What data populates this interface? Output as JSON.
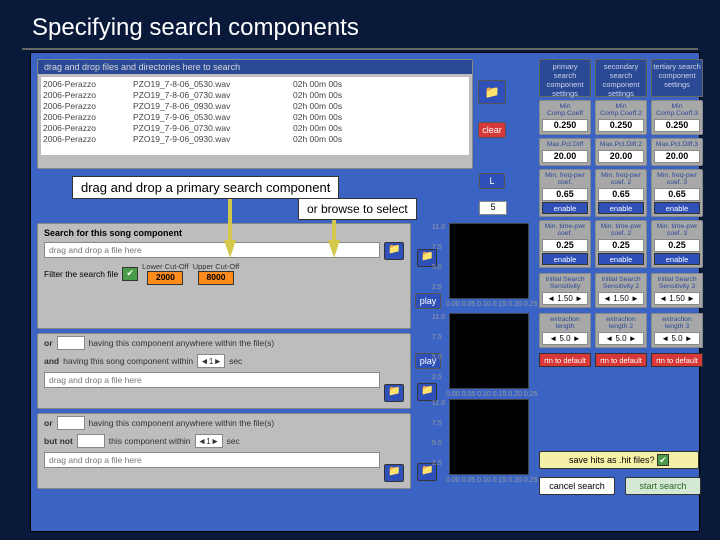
{
  "slide": {
    "title": "Specifying search components"
  },
  "callouts": {
    "main": "drag and drop a primary search component",
    "sub": "or browse to select"
  },
  "fileDrop": {
    "header": "drag and drop files and directories here to search",
    "rows": [
      {
        "a": "2006-Perazzo",
        "b": "PZO19_7-8-06_0530.wav",
        "c": "02h 00m 00s"
      },
      {
        "a": "2006-Perazzo",
        "b": "PZO19_7-8-06_0730.wav",
        "c": "02h 00m 00s"
      },
      {
        "a": "2006-Perazzo",
        "b": "PZO19_7-8-06_0930.wav",
        "c": "02h 00m 00s"
      },
      {
        "a": "2006-Perazzo",
        "b": "PZO19_7-9-06_0530.wav",
        "c": "02h 00m 00s"
      },
      {
        "a": "2006-Perazzo",
        "b": "PZO19_7-9-06_0730.wav",
        "c": "02h 00m 00s"
      },
      {
        "a": "2006-Perazzo",
        "b": "PZO19_7-9-06_0930.wav",
        "c": "02h 00m 00s"
      }
    ]
  },
  "buttons": {
    "clear": "clear",
    "play": "play",
    "L": "L",
    "enable": "enable",
    "rtn": "rtn to default",
    "save": "save hits as .hit files?",
    "cancel": "cancel search",
    "start": "start search"
  },
  "search1": {
    "label": "Search for this song component",
    "drop": "drag and drop a file here",
    "filter": "Filter the search file",
    "lowLbl": "Lower Cut-Off",
    "low": "2000",
    "upLbl": "Upper Cut-Off",
    "up": "8000"
  },
  "search2": {
    "or": "or",
    "orTxt": "having this component anywhere within the file(s)",
    "and": "and",
    "andTxt": "having this song component within",
    "spin": "1",
    "sec": "sec",
    "drop": "drag and drop a file here"
  },
  "search3": {
    "or": "or",
    "orTxt": "having this component anywhere within the file(s)",
    "butnot": "but not",
    "bnTxt": "this component within",
    "spin": "1",
    "sec": "sec",
    "drop": "drag and drop a file here"
  },
  "five": "5",
  "settings": {
    "headers": [
      "primary search component settings",
      "secondary search component settings",
      "tertiary search component settings"
    ],
    "rows": [
      {
        "lbl": [
          "Min Comp.Coeff",
          "Min Comp.Coeff.2",
          "Min Comp.Coeff.3"
        ],
        "val": [
          "0.250",
          "0.250",
          "0.250"
        ]
      },
      {
        "lbl": [
          "Max.Pct.Diff",
          "Max.Pct.Diff.2",
          "Max.Pct.Diff.3"
        ],
        "val": [
          "20.00",
          "20.00",
          "20.00"
        ]
      },
      {
        "lbl": [
          "Min. freq-pwr coef.",
          "Min. freq-pwr coef. 2",
          "Min. freq-pwr coef. 3"
        ],
        "val": [
          "0.65",
          "0.65",
          "0.65"
        ]
      },
      {
        "lbl": [
          "Min. time-pwr coef.",
          "Min. time-pwr coef. 2",
          "Min. time-pwr coef. 3"
        ],
        "val": [
          "0.25",
          "0.25",
          "0.25"
        ]
      },
      {
        "lbl": [
          "Initial Search Sensitivity",
          "Initial Search Sensitivity 2",
          "Initial Search Sensitivity 3"
        ],
        "val": [
          "1.50",
          "1.50",
          "1.50"
        ]
      },
      {
        "lbl": [
          "extraction length",
          "extraction length 2",
          "extraction length 3"
        ],
        "val": [
          "5.0",
          "5.0",
          "5.0"
        ]
      }
    ]
  },
  "axes": {
    "y": [
      "11.0",
      "7.5",
      "5.0",
      "2.5"
    ],
    "x": [
      "0.00",
      "0.05",
      "0.10",
      "0.15",
      "0.20",
      "0.25"
    ]
  }
}
